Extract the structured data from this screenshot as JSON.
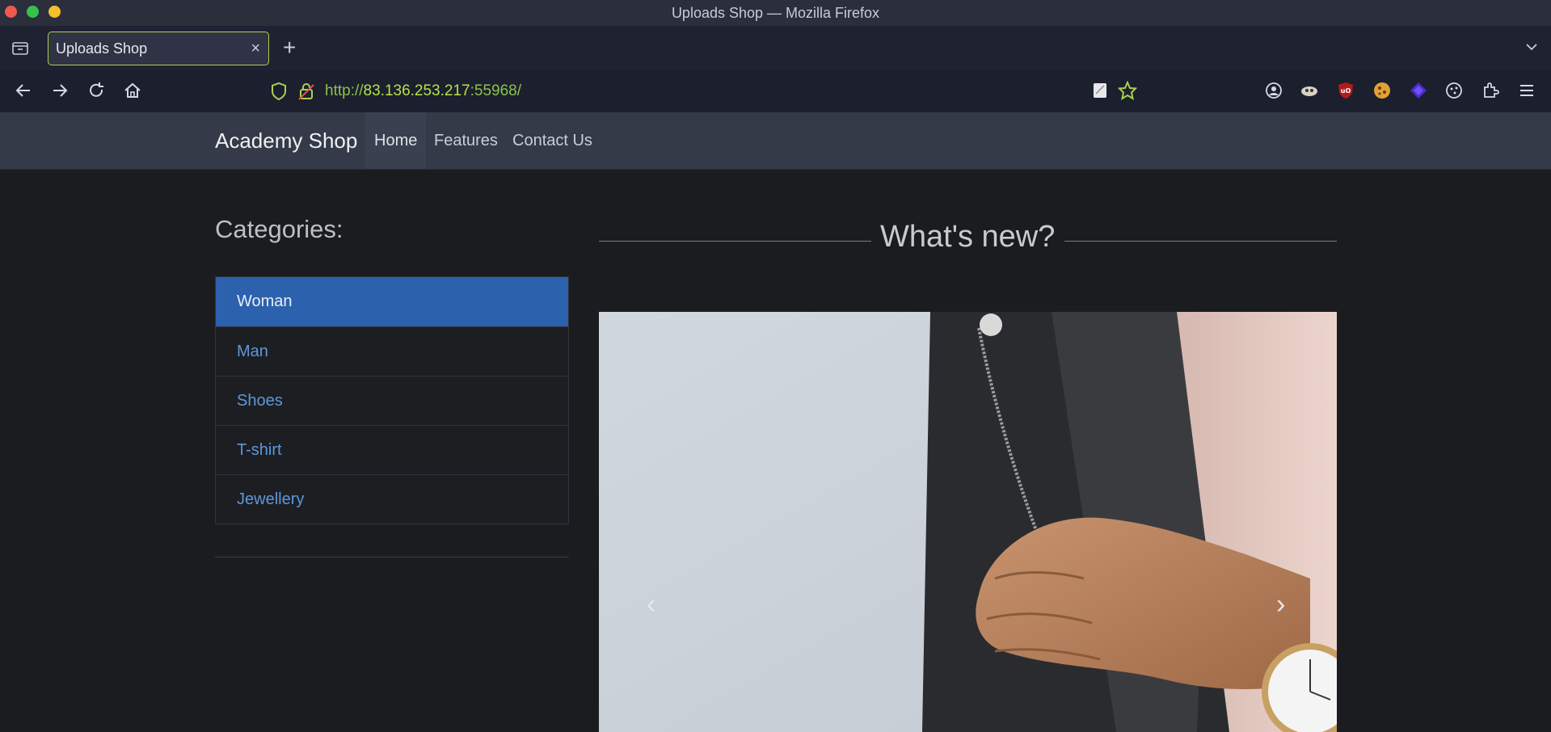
{
  "window": {
    "title": "Uploads Shop — Mozilla Firefox"
  },
  "browser": {
    "tab_title": "Uploads Shop",
    "tab_close": "×",
    "new_tab": "+",
    "url_scheme": "http://",
    "url_host": "83.136.253.217",
    "url_port": ":55968/"
  },
  "site": {
    "brand": "Academy Shop",
    "nav": {
      "home": "Home",
      "features": "Features",
      "contact": "Contact Us"
    },
    "categories_heading": "Categories:",
    "categories": [
      {
        "label": "Woman",
        "active": true
      },
      {
        "label": "Man",
        "active": false
      },
      {
        "label": "Shoes",
        "active": false
      },
      {
        "label": "T-shirt",
        "active": false
      },
      {
        "label": "Jewellery",
        "active": false
      }
    ],
    "whats_new": "What's new?",
    "carousel": {
      "prev": "‹",
      "next": "›"
    }
  },
  "colors": {
    "active_category": "#2c61ae",
    "category_link": "#5d97dc",
    "tab_border": "#a8d14f",
    "url_host": "#b6e04b"
  },
  "icons": [
    "tab-list-icon",
    "back-icon",
    "forward-icon",
    "reload-icon",
    "home-icon",
    "shield-icon",
    "lock-icon",
    "reader-icon",
    "bookmark-star-icon",
    "account-icon",
    "extension-icon",
    "ublock-icon",
    "cookie-icon",
    "diamond-icon",
    "settings-icon",
    "puzzle-icon",
    "menu-icon",
    "chevron-down-icon"
  ]
}
